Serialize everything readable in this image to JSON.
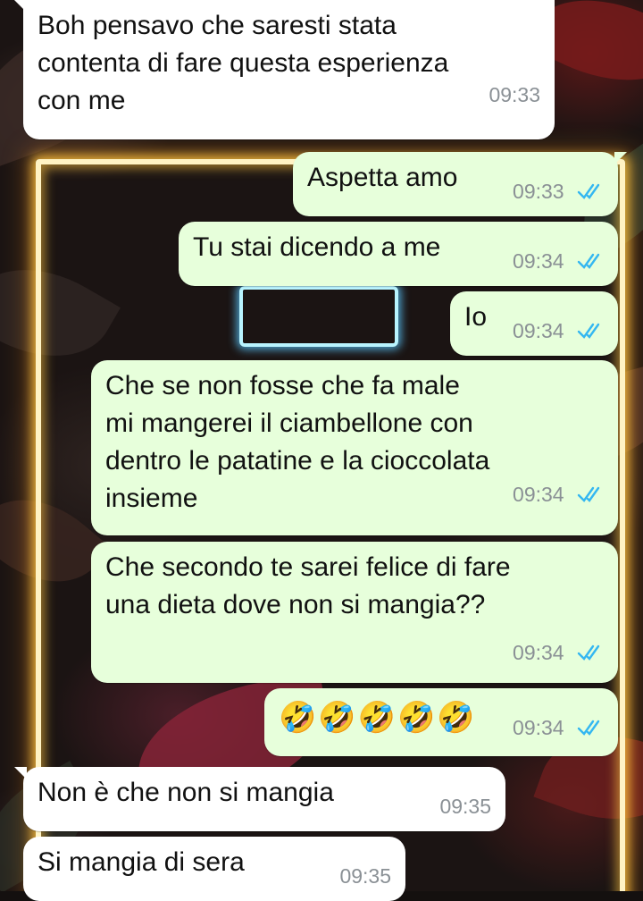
{
  "colors": {
    "incoming_bubble": "#ffffff",
    "outgoing_bubble": "#e7ffdb",
    "read_ticks": "#34b7f1",
    "timestamp": "#8a9095"
  },
  "messages": [
    {
      "direction": "in",
      "text": "Boh pensavo che saresti stata\ncontenta di fare questa esperienza\ncon me",
      "time": "09:33"
    },
    {
      "direction": "out",
      "text": "Aspetta amo",
      "time": "09:33",
      "status": "read"
    },
    {
      "direction": "out",
      "text": "Tu stai dicendo a me",
      "time": "09:34",
      "status": "read"
    },
    {
      "direction": "out",
      "text": "Io",
      "time": "09:34",
      "status": "read"
    },
    {
      "direction": "out",
      "text": "Che se non fosse che fa male\nmi mangerei il ciambellone con\ndentro le patatine e la cioccolata\ninsieme",
      "time": "09:34",
      "status": "read"
    },
    {
      "direction": "out",
      "text": "Che secondo te sarei felice di fare\nuna dieta dove non si mangia??",
      "time": "09:34",
      "status": "read"
    },
    {
      "direction": "out",
      "text": "🤣🤣🤣🤣🤣",
      "time": "09:34",
      "status": "read"
    },
    {
      "direction": "in",
      "text": "Non è che non si mangia",
      "time": "09:35"
    },
    {
      "direction": "in",
      "text": "Si mangia di sera",
      "time": "09:35"
    }
  ]
}
